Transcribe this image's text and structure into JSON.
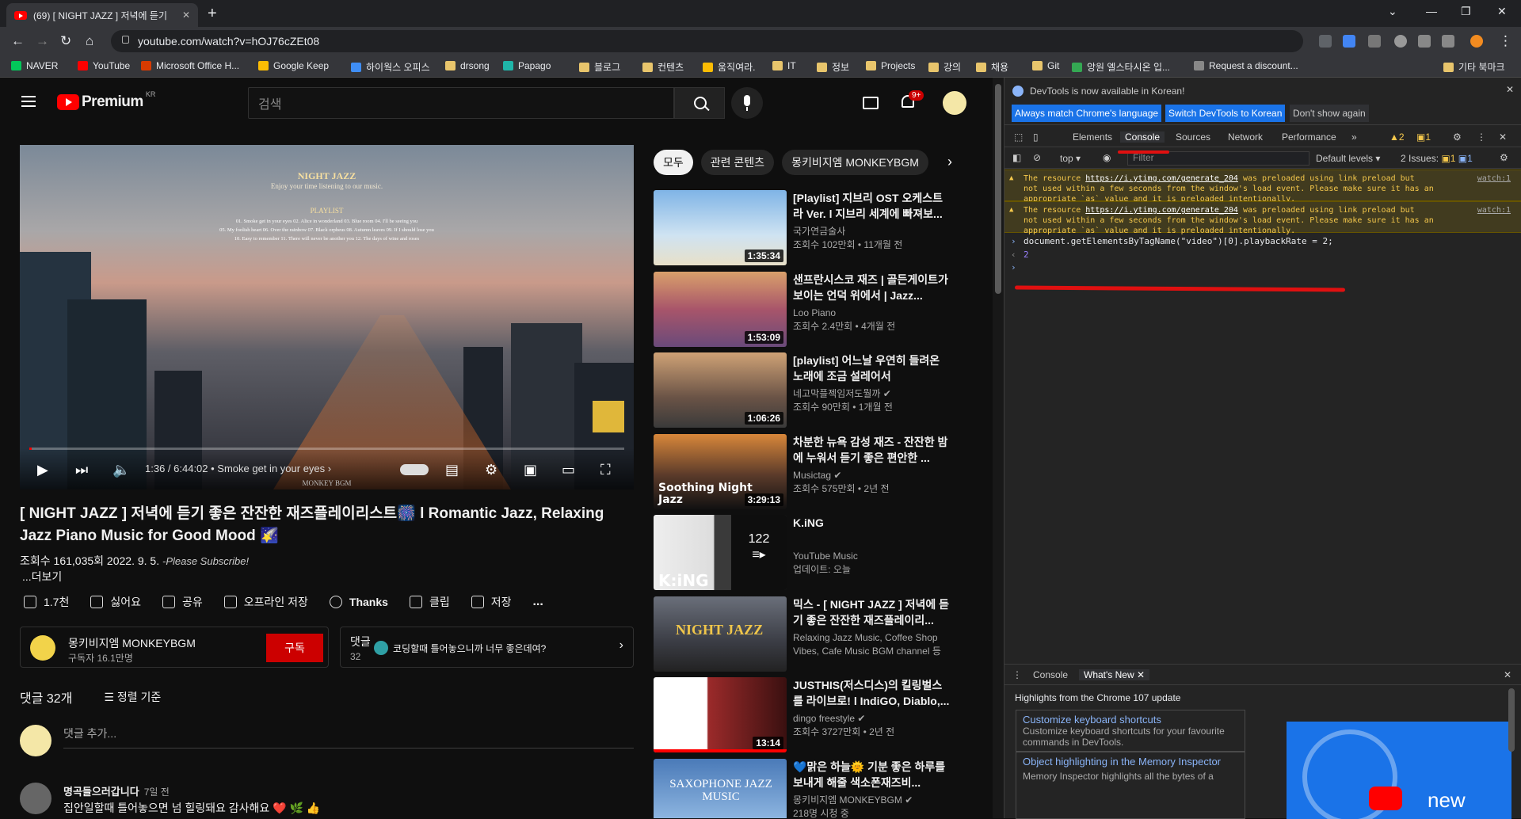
{
  "browser": {
    "tab_title": "(69) [ NIGHT JAZZ ] 저녁에 듣기",
    "url": "youtube.com/watch?v=hOJ76cZEt08",
    "bookmarks": [
      "NAVER",
      "YouTube",
      "Microsoft Office H...",
      "Google Keep",
      "하이웍스 오피스",
      "drsong",
      "Papago",
      "블로그",
      "컨텐츠",
      "움직여라.",
      "IT",
      "정보",
      "Projects",
      "강의",
      "채용",
      "Git",
      "앙원 엘스타시온 입...",
      "Request a discount...",
      "기타 북마크"
    ]
  },
  "youtube": {
    "logo_text": "Premium",
    "logo_region": "KR",
    "search_placeholder": "검색",
    "notif_count": "9+",
    "player": {
      "title_big": "NIGHT JAZZ",
      "subtitle": "Enjoy your time listening to our music.",
      "playlist_label": "PLAYLIST",
      "playlist_line1": "01. Smoke get in your eyes   02. Alice in wonderland   03. Blue room   04. I'll be seeing you",
      "playlist_line2": "05. My foolish heart  06. Over the rainbow  07. Black orpheus  08. Autumn leaves  09. If I should lose you",
      "playlist_line3": "10. Easy to remember   11. There will never be another you   12. The days of wine and roses",
      "time": "1:36 / 6:44:02",
      "chapter": "• Smoke get in your eyes",
      "watermark": "MONKEY BGM",
      "progress": 0.004
    },
    "video_title_line1": "[ NIGHT JAZZ ] 저녁에 듣기 좋은 잔잔한 재즈플레이리스트🎆 l Romantic Jazz, Relaxing",
    "video_title_line2": "Jazz Piano Music for Good Mood 🌠",
    "views": "조회수 161,035회",
    "date": "2022. 9. 5.",
    "desc": "-Please Subscribe!",
    "more": "...더보기",
    "actions": {
      "like": "1.7천",
      "dislike": "싫어요",
      "share": "공유",
      "download": "오프라인 저장",
      "thanks": "Thanks",
      "clip": "클립",
      "save": "저장",
      "more": "..."
    },
    "channel": {
      "name": "몽키비지엠 MONKEYBGM",
      "subs": "구독자 16.1만명",
      "subscribe": "구독"
    },
    "comments_box": {
      "label": "댓글",
      "count": "32",
      "preview": "코딩할때 틀어놓으니까 너무 좋은데여?"
    },
    "comments_header": "댓글 32개",
    "sort_label": "정렬 기준",
    "add_comment": "댓글 추가...",
    "comment1": {
      "author": "명곡들으러갑니다",
      "time": "7일 전",
      "text": "집안일할때 틀어놓으면 넘 힐링돼요 감사해요 ❤️ 🌿 👍"
    },
    "chips": [
      "모두",
      "관련 콘텐츠",
      "몽키비지엠 MONKEYBGM"
    ],
    "recs": [
      {
        "title": "[Playlist] 지브리 OST 오케스트라 Ver. l 지브리 세계에 빠져보...",
        "channel": "국가연금술사",
        "meta": "조회수 102만회 • 11개월 전",
        "dur": "1:35:34"
      },
      {
        "title": "샌프란시스코 재즈 | 골든게이트가 보이는 언덕 위에서 | Jazz...",
        "channel": "Loo Piano",
        "meta": "조회수 2.4만회 • 4개월 전",
        "dur": "1:53:09"
      },
      {
        "title": "[playlist] 어느날 우연히 들려온 노래에 조금 설레어서",
        "channel": "네고막플젝임저도뭘까 ✔",
        "meta": "조회수 90만회 • 1개월 전",
        "dur": "1:06:26"
      },
      {
        "title": "차분한 뉴욕 감성 재즈 - 잔잔한 밤에 누워서 듣기 좋은 편안한 ...",
        "channel": "Musictag ✔",
        "meta": "조회수 575만회 • 2년 전",
        "dur": "3:29:13",
        "overlay": "Soothing Night Jazz"
      },
      {
        "title": "K.iNG",
        "channel": "YouTube Music",
        "meta": "업데이트: 오늘",
        "count": "122",
        "overlay": "K:iNG"
      },
      {
        "title": "믹스 - [ NIGHT JAZZ ] 저녁에 듣기 좋은 잔잔한 재즈플레이리...",
        "channel": "Relaxing Jazz Music, Coffee Shop",
        "meta": "Vibes, Cafe Music BGM channel 등",
        "overlay": "NIGHT JAZZ"
      },
      {
        "title": "JUSTHIS(저스디스)의 킬링벌스를 라이브로! l IndiGO, Diablo,...",
        "channel": "dingo freestyle ✔",
        "meta": "조회수 3727만회 • 2년 전",
        "dur": "13:14"
      },
      {
        "title": "💙맑은 하늘🌞 기분 좋은 하루를 보내게 해줄 색소폰재즈비...",
        "channel": "몽키비지엠 MONKEYBGM ✔",
        "meta": "218명 시청 중",
        "overlay": "SAXOPHONE JAZZ MUSIC"
      }
    ]
  },
  "devtools": {
    "banner": "DevTools is now available in Korean!",
    "btn_match": "Always match Chrome's language",
    "btn_switch": "Switch DevTools to Korean",
    "btn_dont": "Don't show again",
    "tabs": [
      "Elements",
      "Console",
      "Sources",
      "Network",
      "Performance"
    ],
    "warn_count": "2",
    "err_count": "1",
    "context": "top ▾",
    "filter_placeholder": "Filter",
    "levels": "Default levels ▾",
    "issues": "2 Issues: ",
    "issue_w": "1",
    "issue_e": "1",
    "warnings": [
      {
        "pre": "The resource ",
        "link": "https://i.ytimg.com/generate_204",
        "post": " was preloaded using link preload but",
        "line2": "not used within a few seconds from the window's load event. Please make sure it has an",
        "line3": "appropriate `as` value and it is preloaded intentionally.",
        "src": "watch:1"
      },
      {
        "pre": "The resource ",
        "link": "https://i.ytimg.com/generate_204",
        "post": " was preloaded using link preload but",
        "line2": "not used within a few seconds from the window's load event. Please make sure it has an",
        "line3": "appropriate `as` value and it is preloaded intentionally.",
        "src": "watch:1"
      }
    ],
    "input_cmd": "document.getElementsByTagName(\"video\")[0].playbackRate = 2;",
    "output": "2",
    "drawer_tabs": [
      "Console",
      "What's New"
    ],
    "drawer_heading": "Highlights from the Chrome 107 update",
    "news": [
      {
        "title": "Customize keyboard shortcuts",
        "desc": "Customize keyboard shortcuts for your favourite commands in DevTools."
      },
      {
        "title": "Object highlighting in the Memory Inspector",
        "desc": "Memory Inspector highlights all the bytes of a"
      }
    ],
    "promo_text": "new"
  },
  "colors": {
    "accent": "#ff0000",
    "devtools_blue": "#1a73e8",
    "warning": "#f5c84c",
    "annotation": "#e01010"
  }
}
